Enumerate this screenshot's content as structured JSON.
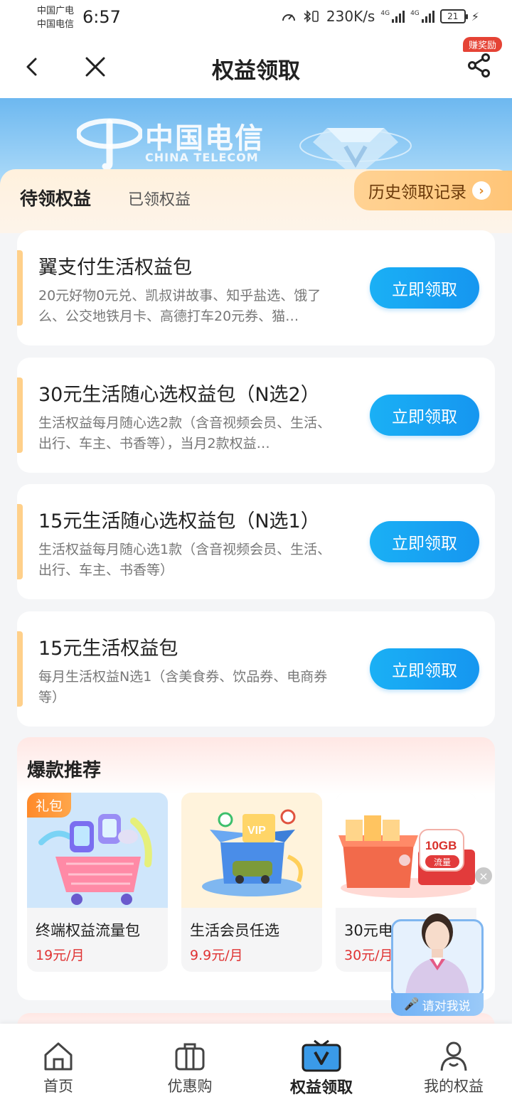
{
  "status_bar": {
    "carrier1": "中国广电",
    "carrier2": "中国电信",
    "time": "6:57",
    "speed": "230K/s",
    "net1": "4G",
    "net2": "4G",
    "battery": "21"
  },
  "header": {
    "title": "权益领取",
    "badge": "赚奖励",
    "icons": [
      "back-icon",
      "close-icon",
      "share-icon"
    ]
  },
  "banner": {
    "brand_cn": "中国电信",
    "brand_en": "CHINA TELECOM"
  },
  "tabs": {
    "active": "待领权益",
    "inactive": "已领权益",
    "history": "历史领取记录"
  },
  "benefits": [
    {
      "name": "翼支付生活权益包",
      "desc": "20元好物0元兑、凯叔讲故事、知乎盐选、饿了么、公交地铁月卡、高德打车20元券、猫…",
      "button": "立即领取"
    },
    {
      "name": "30元生活随心选权益包（N选2）",
      "desc": "生活权益每月随心选2款（含音视频会员、生活、出行、车主、书香等），当月2款权益…",
      "button": "立即领取"
    },
    {
      "name": "15元生活随心选权益包（N选1）",
      "desc": "生活权益每月随心选1款（含音视频会员、生活、出行、车主、书香等）",
      "button": "立即领取"
    },
    {
      "name": "15元生活权益包",
      "desc": "每月生活权益N选1（含美食券、饮品券、电商券等）",
      "button": "立即领取"
    }
  ],
  "hot": {
    "title": "爆款推荐",
    "products": [
      {
        "tag": "礼包",
        "name": "终端权益流量包",
        "price": "19元/月"
      },
      {
        "name": "生活会员任选",
        "price": "9.9元/月",
        "vip": "VIP"
      },
      {
        "name": "30元电",
        "price": "30元/月",
        "data_label": "10GB",
        "data_sub": "流量"
      }
    ]
  },
  "assistant": {
    "label": "请对我说"
  },
  "bottom_nav": [
    {
      "label": "首页",
      "icon": "home-icon"
    },
    {
      "label": "优惠购",
      "icon": "briefcase-icon"
    },
    {
      "label": "权益领取",
      "icon": "tv-v-icon",
      "active": true
    },
    {
      "label": "我的权益",
      "icon": "user-icon"
    }
  ],
  "colors": {
    "accent": "#1696f0",
    "price": "#e03333",
    "orange": "#ffc578"
  }
}
